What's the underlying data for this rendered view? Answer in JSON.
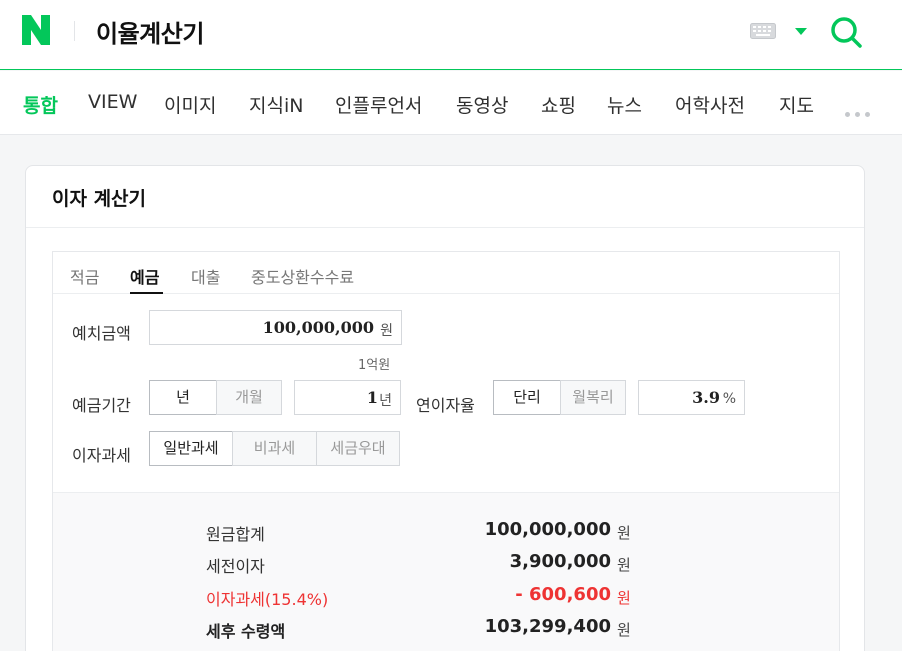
{
  "header": {
    "query": "이율계산기",
    "brand_color": "#03c75a",
    "icons": [
      "naver-logo-icon",
      "keyboard-icon",
      "chevron-down-icon",
      "search-icon"
    ]
  },
  "tabs": [
    "통합",
    "VIEW",
    "이미지",
    "지식iN",
    "인플루언서",
    "동영상",
    "쇼핑",
    "뉴스",
    "어학사전",
    "지도"
  ],
  "active_tab": "통합",
  "card": {
    "title": "이자 계산기",
    "subtabs": [
      "적금",
      "예금",
      "대출",
      "중도상환수수료"
    ],
    "active_subtab": "예금",
    "deposit": {
      "label": "예치금액",
      "value": "100,000,000",
      "unit": "원",
      "hint": "1억원"
    },
    "period": {
      "label": "예금기간",
      "options": [
        "년",
        "개월"
      ],
      "selected": "년",
      "value": "1",
      "unit": "년"
    },
    "rate": {
      "label": "연이자율",
      "options": [
        "단리",
        "월복리"
      ],
      "selected": "단리",
      "value": "3.9",
      "unit": "%"
    },
    "tax": {
      "label": "이자과세",
      "options": [
        "일반과세",
        "비과세",
        "세금우대"
      ],
      "selected": "일반과세"
    },
    "results": [
      {
        "label": "원금합계",
        "value": "100,000,000",
        "unit": "원"
      },
      {
        "label": "세전이자",
        "value": "3,900,000",
        "unit": "원"
      },
      {
        "label": "이자과세(15.4%)",
        "value": "- 600,600",
        "unit": "원"
      },
      {
        "label": "세후 수령액",
        "value": "103,299,400",
        "unit": "원"
      }
    ],
    "accent_red": "#e33333"
  }
}
